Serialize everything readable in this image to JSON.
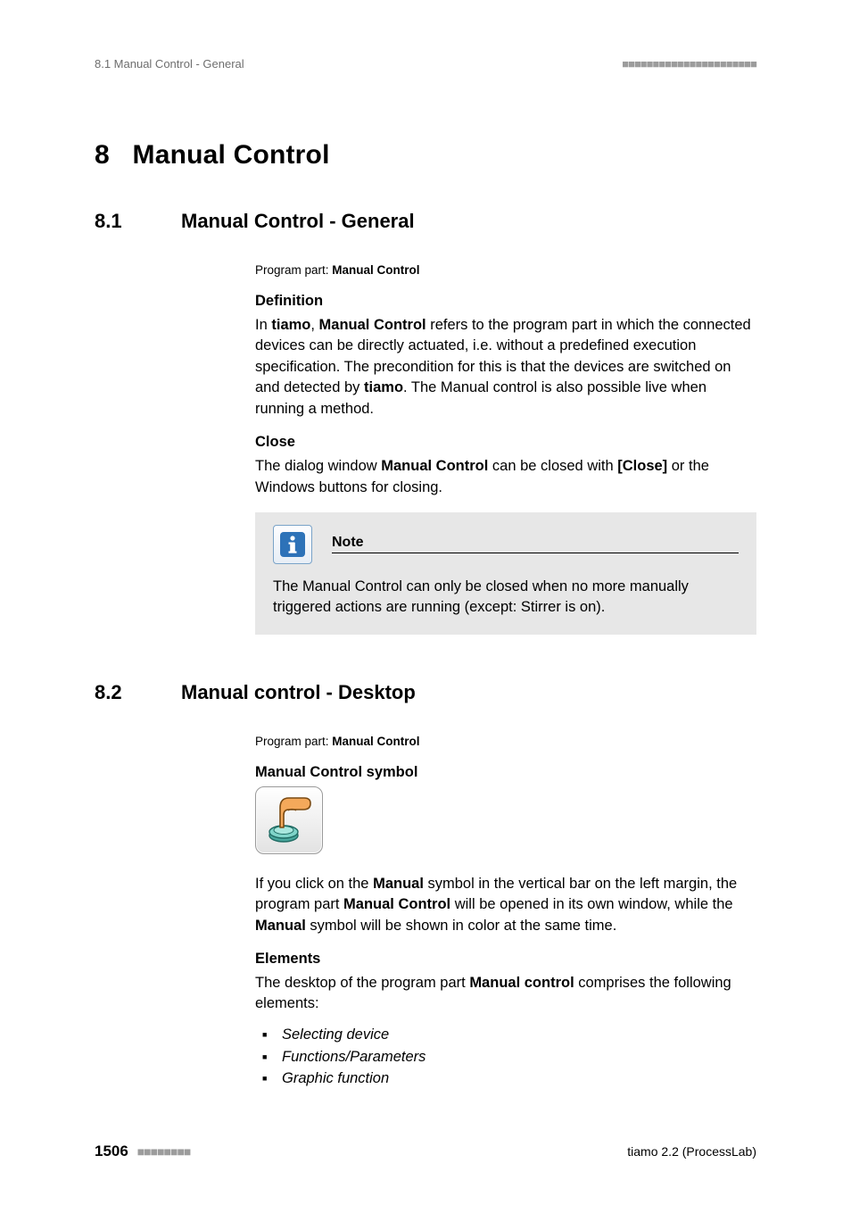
{
  "header": {
    "left": "8.1 Manual Control - General",
    "right": "■■■■■■■■■■■■■■■■■■■■■■"
  },
  "chapter": {
    "number": "8",
    "title": "Manual Control"
  },
  "sections": [
    {
      "number": "8.1",
      "title": "Manual Control - General",
      "program_part_label": "Program part: ",
      "program_part_value": "Manual Control",
      "blocks": [
        {
          "heading": "Definition",
          "paragraph_parts": [
            {
              "t": "In "
            },
            {
              "t": "tiamo",
              "b": true
            },
            {
              "t": ", "
            },
            {
              "t": "Manual Control",
              "b": true
            },
            {
              "t": " refers to the program part in which the connected devices can be directly actuated, i.e. without a predefined execution specification. The precondition for this is that the devices are switched on and detected by "
            },
            {
              "t": "tiamo",
              "b": true
            },
            {
              "t": ". The Manual control is also possible live when running a method."
            }
          ]
        },
        {
          "heading": "Close",
          "paragraph_parts": [
            {
              "t": "The dialog window "
            },
            {
              "t": "Manual Control",
              "b": true
            },
            {
              "t": " can be closed with "
            },
            {
              "t": "[Close]",
              "b": true
            },
            {
              "t": " or the Windows buttons for closing."
            }
          ]
        }
      ],
      "note": {
        "title": "Note",
        "body": "The Manual Control can only be closed when no more manually triggered actions are running (except: Stirrer is on)."
      }
    },
    {
      "number": "8.2",
      "title": "Manual control - Desktop",
      "program_part_label": "Program part: ",
      "program_part_value": "Manual Control",
      "blocks": [
        {
          "heading": "Manual Control symbol",
          "symbol": true,
          "paragraph_parts": [
            {
              "t": "If you click on the "
            },
            {
              "t": "Manual",
              "b": true
            },
            {
              "t": " symbol in the vertical bar on the left margin, the program part "
            },
            {
              "t": "Manual Control",
              "b": true
            },
            {
              "t": " will be opened in its own window, while the "
            },
            {
              "t": "Manual",
              "b": true
            },
            {
              "t": " symbol will be shown in color at the same time."
            }
          ]
        },
        {
          "heading": "Elements",
          "paragraph_parts": [
            {
              "t": "The desktop of the program part "
            },
            {
              "t": "Manual control",
              "b": true
            },
            {
              "t": " comprises the following elements:"
            }
          ],
          "list": [
            "Selecting device",
            "Functions/Parameters",
            "Graphic function"
          ]
        }
      ]
    }
  ],
  "footer": {
    "page": "1506",
    "dashes": "■■■■■■■■",
    "right": "tiamo 2.2 (ProcessLab)"
  },
  "icons": {
    "info": "info-icon",
    "manual_symbol": "hand-button-icon"
  }
}
